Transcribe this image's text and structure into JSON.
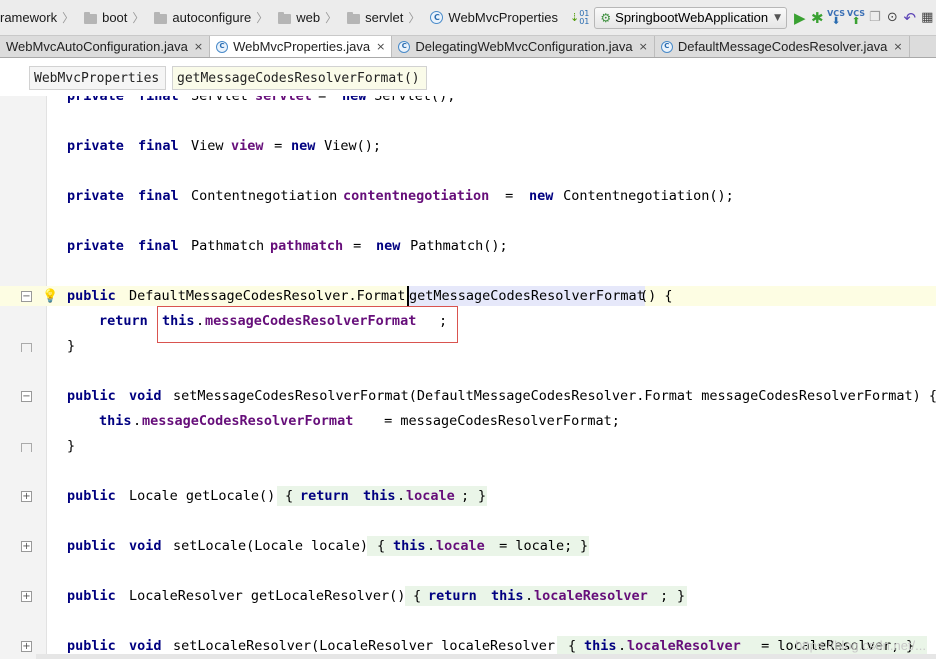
{
  "breadcrumbs": [
    {
      "label": "ramework",
      "icon": "folder"
    },
    {
      "label": "boot",
      "icon": "folder"
    },
    {
      "label": "autoconfigure",
      "icon": "folder"
    },
    {
      "label": "web",
      "icon": "folder"
    },
    {
      "label": "servlet",
      "icon": "folder"
    },
    {
      "label": "WebMvcProperties",
      "icon": "class"
    }
  ],
  "toolbar": {
    "run_config": "SpringbootWebApplication",
    "vcs_label": "VCS"
  },
  "class_icon_letter": "C",
  "tabs": [
    {
      "label": "WebMvcAutoConfiguration.java",
      "active": false
    },
    {
      "label": "WebMvcProperties.java",
      "active": true
    },
    {
      "label": "DelegatingWebMvcConfiguration.java",
      "active": false
    },
    {
      "label": "DefaultMessageCodesResolver.java",
      "active": false
    }
  ],
  "close_glyph": "×",
  "structure": {
    "class_name": "WebMvcProperties",
    "method_name": "getMessageCodesResolverFormat()"
  },
  "code": {
    "l1": {
      "kw1": "private",
      "kw2": "final",
      "type": "Servlet",
      "field": "servlet",
      "eq": " = ",
      "kw3": "new",
      "rest": " Servlet();"
    },
    "l2": {
      "kw1": "private",
      "kw2": "final",
      "type": "View",
      "field": "view",
      "eq": " = ",
      "kw3": "new",
      "rest": " View();"
    },
    "l3": {
      "kw1": "private",
      "kw2": "final",
      "type": "Contentnegotiation",
      "field": "contentnegotiation",
      "eq": " = ",
      "kw3": "new",
      "rest": " Contentnegotiation();"
    },
    "l4": {
      "kw1": "private",
      "kw2": "final",
      "type": "Pathmatch",
      "field": "pathmatch",
      "eq": " = ",
      "kw3": "new",
      "rest": " Pathmatch();"
    },
    "l5": {
      "kw1": "public",
      "type": "DefaultMessageCodesResolver.Format",
      "method": "getMessageCodesResolverFormat",
      "rest": "() {"
    },
    "l6": {
      "kw1": "return",
      "kw2": "this",
      "dot": ".",
      "field": "messageCodesResolverFormat",
      "rest": ";"
    },
    "l7": {
      "rest": "}"
    },
    "l8": {
      "kw1": "public",
      "kw2": "void",
      "rest": "setMessageCodesResolverFormat(DefaultMessageCodesResolver.Format messageCodesResolverFormat) {"
    },
    "l9": {
      "kw1": "this",
      "dot": ".",
      "field": "messageCodesResolverFormat",
      "rest": " = messageCodesResolverFormat;"
    },
    "l10": {
      "rest": "}"
    },
    "l11": {
      "kw1": "public",
      "head": "Locale getLocale() ",
      "brace1": "{",
      "kw2": "return",
      "kw3": "this",
      "dot": ".",
      "field": "locale",
      "semi": ";",
      "brace2": "}"
    },
    "l12": {
      "kw1": "public",
      "kw2": "void",
      "head": "setLocale(Locale locale) ",
      "brace1": "{",
      "kw3": "this",
      "dot": ".",
      "field": "locale",
      "semi": " = locale;",
      "brace2": "}"
    },
    "l13": {
      "kw1": "public",
      "head": "LocaleResolver getLocaleResolver() ",
      "brace1": "{",
      "kw2": "return",
      "kw3": "this",
      "dot": ".",
      "field": "localeResolver",
      "semi": ";",
      "brace2": "}"
    },
    "l14": {
      "kw1": "public",
      "kw2": "void",
      "head": "setLocaleResolver(LocaleResolver localeResolver) ",
      "brace1": "{",
      "kw3": "this",
      "dot": ".",
      "field": "localeResolver",
      "semi": " = localeResolver;",
      "brace2": "}"
    }
  },
  "watermark": "https://blog.csdn.net/..."
}
